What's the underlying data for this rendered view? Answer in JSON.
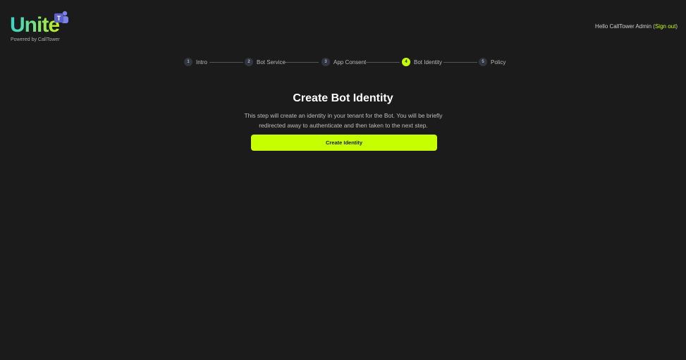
{
  "header": {
    "logo_text": "Unite",
    "logo_tagline": "Powered by CallTower",
    "teams_badge_letter": "T",
    "greeting_prefix": "Hello CallTower Admin (",
    "sign_out_label": "Sign out",
    "greeting_suffix": ")"
  },
  "stepper": {
    "steps": [
      {
        "number": "1",
        "label": "Intro"
      },
      {
        "number": "2",
        "label": "Bot Service"
      },
      {
        "number": "3",
        "label": "App Consent"
      },
      {
        "number": "4",
        "label": "Bot Identity"
      },
      {
        "number": "5",
        "label": "Policy"
      }
    ],
    "active_step": 4
  },
  "main": {
    "title": "Create Bot Identity",
    "description": "This step will create an identity in your tenant for the Bot. You will be briefly redirected away to authenticate and then taken to the next step.",
    "create_button_label": "Create Identity"
  },
  "colors": {
    "background": "#1b1b1b",
    "accent": "#c6ff00",
    "step_inactive": "#31353d",
    "teams_purple": "#5b5fc7"
  }
}
